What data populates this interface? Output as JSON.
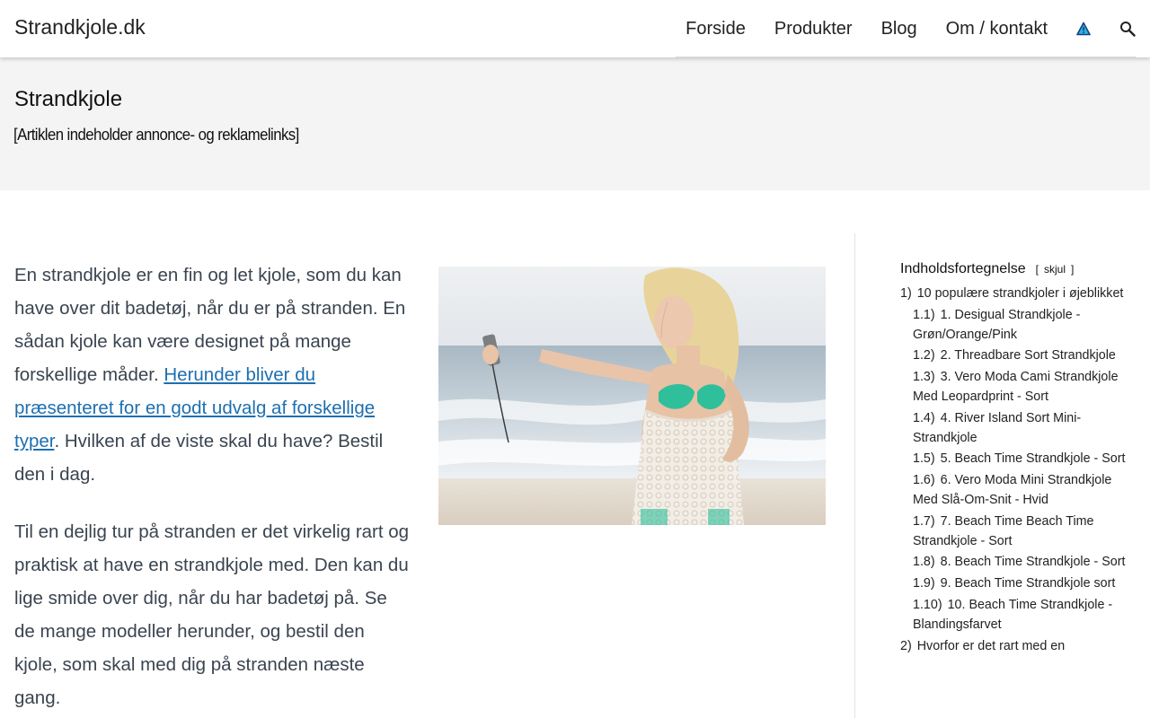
{
  "header": {
    "brand": "Strandkjole.dk",
    "nav": [
      "Forside",
      "Produkter",
      "Blog",
      "Om / kontakt"
    ]
  },
  "title_band": {
    "title": "Strandkjole",
    "disclaimer": "[Artiklen indeholder annonce- og reklamelinks]"
  },
  "content": {
    "para1_before": "En strandkjole er en fin og let kjole, som du kan have over dit badetøj, når du er på stranden. En sådan kjole kan være designet på mange forskellige måder. ",
    "para1_link": "Herunder bliver du præsenteret for en godt udvalg af forskellige typer",
    "para1_after": ". Hvilken af de viste skal du have? Bestil den i dag.",
    "para2": "Til en dejlig tur på stranden er det virkelig rart og praktisk at have en strandkjole med. Den kan du lige smide over dig, når du har badetøj på. Se de mange modeller herunder, og bestil den kjole, som skal med dig på stranden næste gang."
  },
  "toc": {
    "title": "Indholdsfortegnelse",
    "toggle_open": "[",
    "toggle_label": "skjul",
    "toggle_close": "]",
    "items": [
      {
        "num": "1)",
        "text": "10 populære strandkjoler i øjeblikket",
        "level": 1
      },
      {
        "num": "1.1)",
        "text": "1. Desigual Strandkjole - Grøn/Orange/Pink",
        "level": 2
      },
      {
        "num": "1.2)",
        "text": "2. Threadbare Sort Strandkjole",
        "level": 2
      },
      {
        "num": "1.3)",
        "text": "3. Vero Moda Cami Strandkjole Med Leopardprint - Sort",
        "level": 2
      },
      {
        "num": "1.4)",
        "text": "4. River Island Sort Mini-Strandkjole",
        "level": 2
      },
      {
        "num": "1.5)",
        "text": "5. Beach Time Strandkjole - Sort",
        "level": 2
      },
      {
        "num": "1.6)",
        "text": "6. Vero Moda Mini Strandkjole Med Slå-Om-Snit - Hvid",
        "level": 2
      },
      {
        "num": "1.7)",
        "text": "7. Beach Time Beach Time Strandkjole - Sort",
        "level": 2
      },
      {
        "num": "1.8)",
        "text": "8. Beach Time Strandkjole - Sort",
        "level": 2
      },
      {
        "num": "1.9)",
        "text": "9. Beach Time Strandkjole sort",
        "level": 2
      },
      {
        "num": "1.10)",
        "text": "10. Beach Time Strandkjole - Blandingsfarvet",
        "level": 2
      },
      {
        "num": "2)",
        "text": "Hvorfor er det rart med en",
        "level": 1
      }
    ]
  },
  "colors": {
    "link": "#1e6fb0",
    "title_band_bg": "#f4f4f4",
    "body_text": "#3a4450"
  },
  "icons": [
    "warning-icon",
    "search-icon"
  ]
}
